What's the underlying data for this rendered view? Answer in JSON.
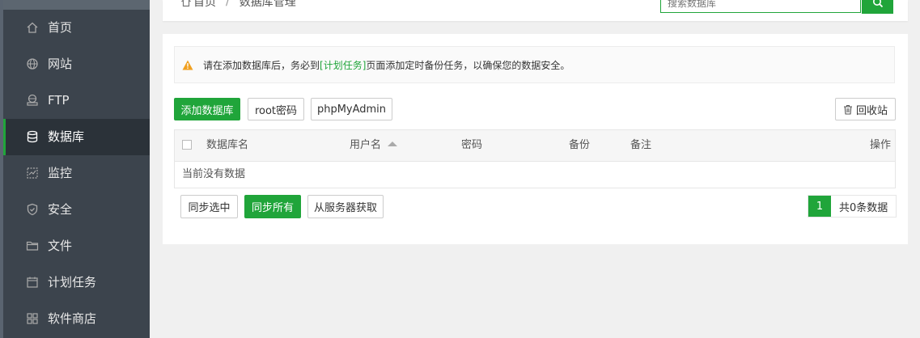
{
  "sidebar": {
    "items": [
      {
        "label": "首页",
        "icon": "home-icon"
      },
      {
        "label": "网站",
        "icon": "globe-icon"
      },
      {
        "label": "FTP",
        "icon": "ftp-icon"
      },
      {
        "label": "数据库",
        "icon": "database-icon",
        "active": true
      },
      {
        "label": "监控",
        "icon": "monitor-icon"
      },
      {
        "label": "安全",
        "icon": "shield-icon"
      },
      {
        "label": "文件",
        "icon": "folder-icon"
      },
      {
        "label": "计划任务",
        "icon": "calendar-icon"
      },
      {
        "label": "软件商店",
        "icon": "apps-icon"
      }
    ]
  },
  "breadcrumb": {
    "home": "首页",
    "separator": "/",
    "current": "数据库管理"
  },
  "search": {
    "placeholder": "搜索数据库"
  },
  "alert": {
    "prefix": "请在添加数据库后，务必到",
    "link": "[计划任务]",
    "suffix": "页面添加定时备份任务，以确保您的数据安全。"
  },
  "toolbar": {
    "add_db": "添加数据库",
    "root_pwd": "root密码",
    "phpmyadmin": "phpMyAdmin",
    "recycle": "回收站"
  },
  "table": {
    "columns": [
      "数据库名",
      "用户名",
      "密码",
      "备份",
      "备注",
      "操作"
    ],
    "empty_text": "当前没有数据"
  },
  "bottom": {
    "sync_selected": "同步选中",
    "sync_all": "同步所有",
    "fetch_server": "从服务器获取"
  },
  "pager": {
    "current_page": "1",
    "total": "共0条数据"
  },
  "colors": {
    "accent": "#20a53a",
    "sidebar_bg": "#3c444d",
    "sidebar_active": "#2b3239"
  }
}
